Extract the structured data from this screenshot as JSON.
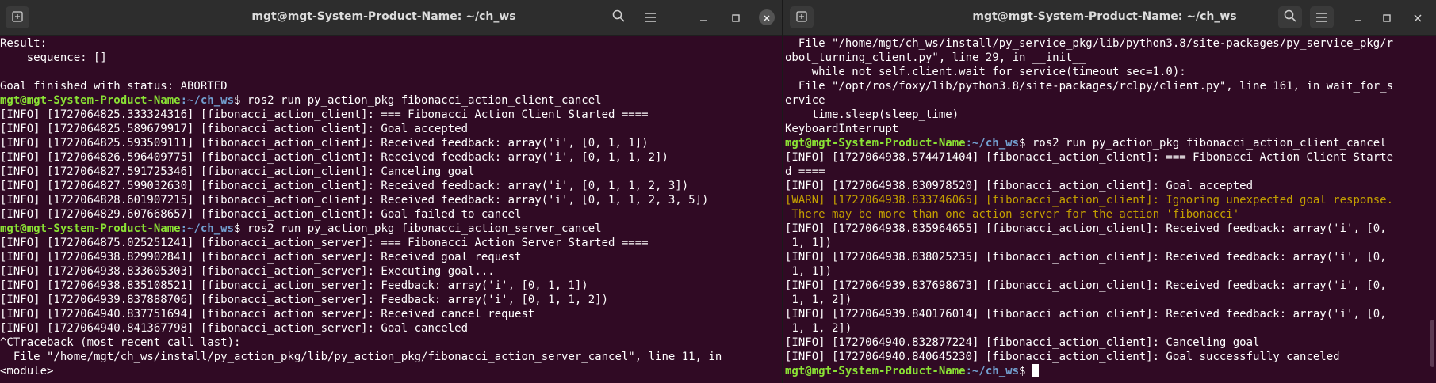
{
  "left_window": {
    "title": "mgt@mgt-System-Product-Name: ~/ch_ws",
    "icons": {
      "new_tab": "new-tab-icon",
      "search": "search-icon",
      "menu": "hamburger-menu-icon",
      "minimize": "minimize-icon",
      "maximize": "maximize-icon",
      "close": "close-icon"
    },
    "lines": [
      {
        "text": "Result:"
      },
      {
        "text": "    sequence: []"
      },
      {
        "text": ""
      },
      {
        "text": "Goal finished with status: ABORTED"
      },
      {
        "user": "mgt@mgt-System-Product-Name",
        "path": ":~/ch_ws",
        "cmd": "$ ros2 run py_action_pkg fibonacci_action_client_cancel"
      },
      {
        "text": "[INFO] [1727064825.333324316] [fibonacci_action_client]: === Fibonacci Action Client Started ===="
      },
      {
        "text": "[INFO] [1727064825.589679917] [fibonacci_action_client]: Goal accepted"
      },
      {
        "text": "[INFO] [1727064825.593509111] [fibonacci_action_client]: Received feedback: array('i', [0, 1, 1])"
      },
      {
        "text": "[INFO] [1727064826.596409775] [fibonacci_action_client]: Received feedback: array('i', [0, 1, 1, 2])"
      },
      {
        "text": "[INFO] [1727064827.591725346] [fibonacci_action_client]: Canceling goal"
      },
      {
        "text": "[INFO] [1727064827.599032630] [fibonacci_action_client]: Received feedback: array('i', [0, 1, 1, 2, 3])"
      },
      {
        "text": "[INFO] [1727064828.601907215] [fibonacci_action_client]: Received feedback: array('i', [0, 1, 1, 2, 3, 5])"
      },
      {
        "text": "[INFO] [1727064829.607668657] [fibonacci_action_client]: Goal failed to cancel"
      },
      {
        "user": "mgt@mgt-System-Product-Name",
        "path": ":~/ch_ws",
        "cmd": "$ ros2 run py_action_pkg fibonacci_action_server_cancel"
      },
      {
        "text": "[INFO] [1727064875.025251241] [fibonacci_action_server]: === Fibonacci Action Server Started ===="
      },
      {
        "text": "[INFO] [1727064938.829902841] [fibonacci_action_server]: Received goal request"
      },
      {
        "text": "[INFO] [1727064938.833605303] [fibonacci_action_server]: Executing goal..."
      },
      {
        "text": "[INFO] [1727064938.835108521] [fibonacci_action_server]: Feedback: array('i', [0, 1, 1])"
      },
      {
        "text": "[INFO] [1727064939.837888706] [fibonacci_action_server]: Feedback: array('i', [0, 1, 1, 2])"
      },
      {
        "text": "[INFO] [1727064940.837751694] [fibonacci_action_server]: Received cancel request"
      },
      {
        "text": "[INFO] [1727064940.841367798] [fibonacci_action_server]: Goal canceled"
      },
      {
        "text": "^CTraceback (most recent call last):"
      },
      {
        "text": "  File \"/home/mgt/ch_ws/install/py_action_pkg/lib/py_action_pkg/fibonacci_action_server_cancel\", line 11, in"
      },
      {
        "text": "<module>"
      }
    ]
  },
  "right_window": {
    "title": "mgt@mgt-System-Product-Name: ~/ch_ws",
    "icons": {
      "new_tab": "new-tab-icon",
      "search": "search-icon",
      "menu": "hamburger-menu-icon",
      "minimize": "minimize-icon",
      "maximize": "maximize-icon",
      "close": "close-icon"
    },
    "lines": [
      {
        "text": "  File \"/home/mgt/ch_ws/install/py_service_pkg/lib/python3.8/site-packages/py_service_pkg/r"
      },
      {
        "text": "obot_turning_client.py\", line 29, in __init__"
      },
      {
        "text": "    while not self.client.wait_for_service(timeout_sec=1.0):"
      },
      {
        "text": "  File \"/opt/ros/foxy/lib/python3.8/site-packages/rclpy/client.py\", line 161, in wait_for_s"
      },
      {
        "text": "ervice"
      },
      {
        "text": "    time.sleep(sleep_time)"
      },
      {
        "text": "KeyboardInterrupt"
      },
      {
        "user": "mgt@mgt-System-Product-Name",
        "path": ":~/ch_ws",
        "cmd": "$ ros2 run py_action_pkg fibonacci_action_client_cancel"
      },
      {
        "text": "[INFO] [1727064938.574471404] [fibonacci_action_client]: === Fibonacci Action Client Starte"
      },
      {
        "text": "d ===="
      },
      {
        "text": "[INFO] [1727064938.830978520] [fibonacci_action_client]: Goal accepted"
      },
      {
        "warn": "[WARN] [1727064938.833746065] [fibonacci_action_client]: Ignoring unexpected goal response."
      },
      {
        "warn": " There may be more than one action server for the action 'fibonacci'"
      },
      {
        "text": "[INFO] [1727064938.835964655] [fibonacci_action_client]: Received feedback: array('i', [0,"
      },
      {
        "text": " 1, 1])"
      },
      {
        "text": "[INFO] [1727064938.838025235] [fibonacci_action_client]: Received feedback: array('i', [0,"
      },
      {
        "text": " 1, 1])"
      },
      {
        "text": "[INFO] [1727064939.837698673] [fibonacci_action_client]: Received feedback: array('i', [0,"
      },
      {
        "text": " 1, 1, 2])"
      },
      {
        "text": "[INFO] [1727064939.840176014] [fibonacci_action_client]: Received feedback: array('i', [0,"
      },
      {
        "text": " 1, 1, 2])"
      },
      {
        "text": "[INFO] [1727064940.832877224] [fibonacci_action_client]: Canceling goal"
      },
      {
        "text": "[INFO] [1727064940.840645230] [fibonacci_action_client]: Goal successfully canceled"
      },
      {
        "user": "mgt@mgt-System-Product-Name",
        "path": ":~/ch_ws",
        "cmd": "$ ",
        "cursor": true
      }
    ]
  }
}
